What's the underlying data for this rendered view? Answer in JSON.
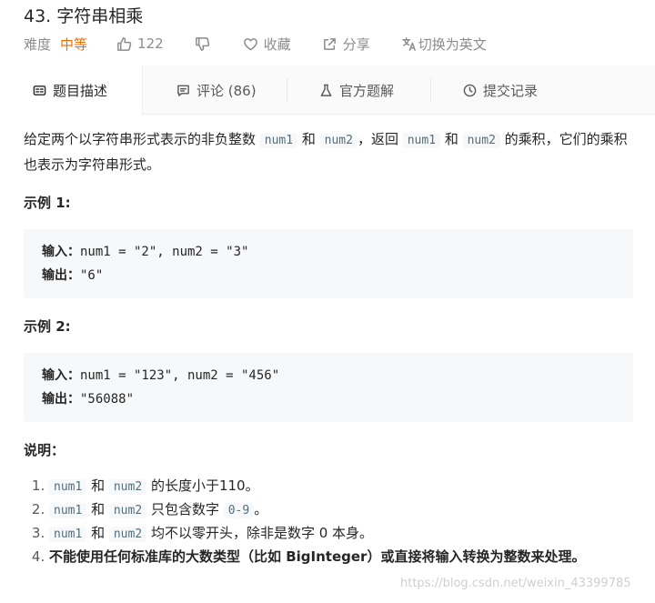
{
  "problem": {
    "title": "43. 字符串相乘",
    "difficulty_label": "难度",
    "difficulty_value": "中等",
    "likes": "122",
    "favorite_label": "收藏",
    "share_label": "分享",
    "translate_label": "切换为英文"
  },
  "tabs": [
    {
      "label": "题目描述",
      "icon": "description-icon"
    },
    {
      "label": "评论 (86)",
      "icon": "comment-icon"
    },
    {
      "label": "官方题解",
      "icon": "flask-icon"
    },
    {
      "label": "提交记录",
      "icon": "clock-icon"
    }
  ],
  "description": {
    "p1_a": "给定两个以字符串形式表示的非负整数 ",
    "code_num1": "num1",
    "p1_and": " 和 ",
    "code_num2": "num2",
    "p1_b": "，返回 ",
    "p1_c": " 的乘积，它们的乘积也表示为字符串形式。"
  },
  "examples": [
    {
      "heading": "示例 1:",
      "input_label": "输入：",
      "input": "num1 = \"2\", num2 = \"3\"",
      "output_label": "输出：",
      "output": "\"6\""
    },
    {
      "heading": "示例 2:",
      "input_label": "输入：",
      "input": "num1 = \"123\", num2 = \"456\"",
      "output_label": "输出：",
      "output": "\"56088\""
    }
  ],
  "notes": {
    "heading": "说明：",
    "item1_tail": " 的长度小于110。",
    "item2_mid": " 只包含数字 ",
    "item2_code": "0-9",
    "item2_tail": "。",
    "item3_tail": " 均不以零开头，除非是数字 0 本身。",
    "item4": "不能使用任何标准库的大数类型（比如 BigInteger）或直接将输入转换为整数来处理。"
  },
  "watermark": "https://blog.csdn.net/weixin_43399785",
  "colors": {
    "accent": "#ef6c00",
    "code_bg": "#f7f8fa"
  }
}
